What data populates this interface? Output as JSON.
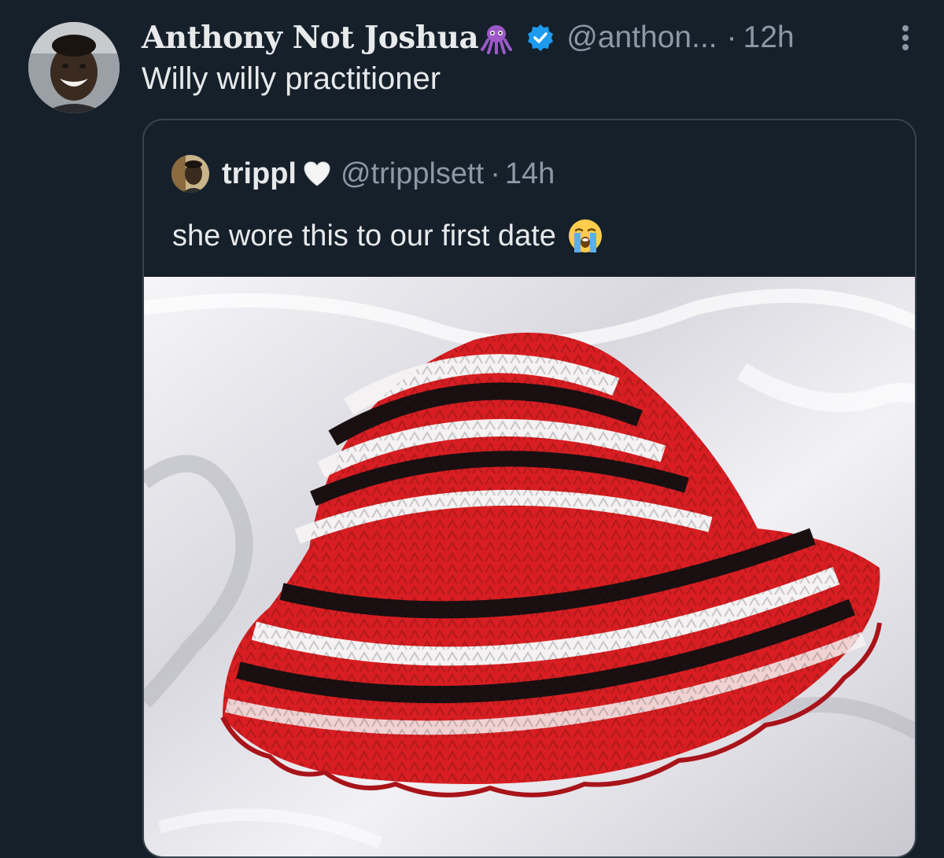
{
  "tweet": {
    "display_name": "Anthony Not Joshua",
    "name_emoji": "octopus-emoji-icon",
    "verified": true,
    "handle": "@anthon...",
    "separator": "·",
    "time": "12h",
    "text": "Willy willy practitioner",
    "more_icon": "more-vertical-icon"
  },
  "quote": {
    "display_name": "trippl",
    "name_emoji": "white-heart-emoji-icon",
    "handle": "@tripplsett",
    "separator": "·",
    "time": "14h",
    "text": "she wore this to our first date",
    "text_emoji": "loudly-crying-face-emoji-icon",
    "media": "photo-crochet-bucket-hat"
  },
  "colors": {
    "background": "#15202b",
    "text_primary": "#e7e9ea",
    "text_secondary": "#8b98a5",
    "border": "#38444d",
    "verified_blue": "#1d9bf0"
  }
}
